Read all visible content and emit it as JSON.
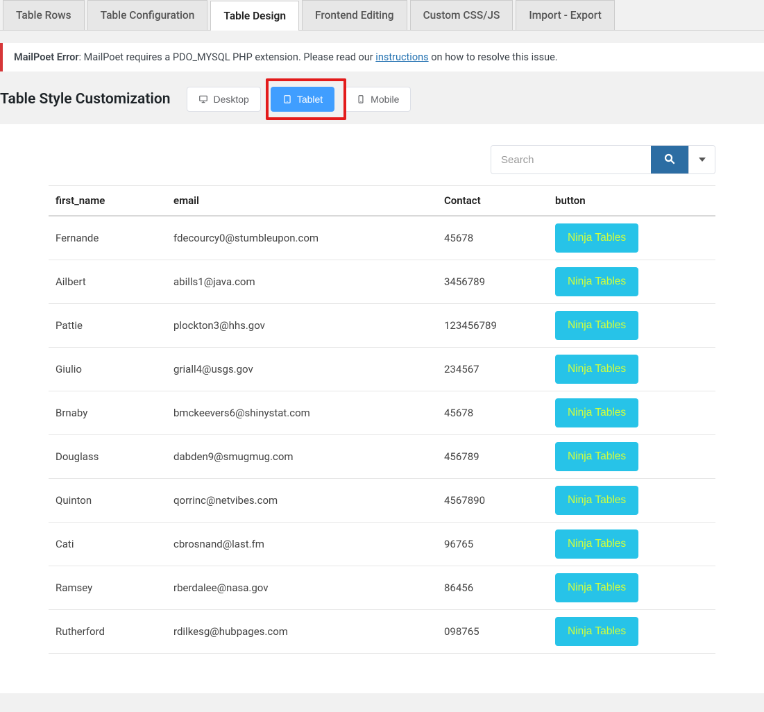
{
  "tabs": [
    {
      "label": "Table Rows",
      "active": false
    },
    {
      "label": "Table Configuration",
      "active": false
    },
    {
      "label": "Table Design",
      "active": true
    },
    {
      "label": "Frontend Editing",
      "active": false
    },
    {
      "label": "Custom CSS/JS",
      "active": false
    },
    {
      "label": "Import - Export",
      "active": false
    }
  ],
  "banner": {
    "prefix": "MailPoet Error",
    "text_before_link": ": MailPoet requires a PDO_MYSQL PHP extension. Please read our ",
    "link_text": "instructions",
    "text_after_link": " on how to resolve this issue."
  },
  "heading": "Table Style Customization",
  "devices": {
    "desktop": "Desktop",
    "tablet": "Tablet",
    "mobile": "Mobile",
    "active": "tablet"
  },
  "search": {
    "placeholder": "Search",
    "value": ""
  },
  "table": {
    "columns": [
      "first_name",
      "email",
      "Contact",
      "button"
    ],
    "button_label": "Ninja Tables",
    "rows": [
      {
        "first_name": "Fernande",
        "email": "fdecourcy0@stumbleupon.com",
        "contact": "45678"
      },
      {
        "first_name": "Ailbert",
        "email": "abills1@java.com",
        "contact": "3456789"
      },
      {
        "first_name": "Pattie",
        "email": "plockton3@hhs.gov",
        "contact": "123456789"
      },
      {
        "first_name": "Giulio",
        "email": "griall4@usgs.gov",
        "contact": "234567"
      },
      {
        "first_name": "Brnaby",
        "email": "bmckeevers6@shinystat.com",
        "contact": "45678"
      },
      {
        "first_name": "Douglass",
        "email": "dabden9@smugmug.com",
        "contact": "456789"
      },
      {
        "first_name": "Quinton",
        "email": "qorrinc@netvibes.com",
        "contact": "4567890"
      },
      {
        "first_name": "Cati",
        "email": "cbrosnand@last.fm",
        "contact": "96765"
      },
      {
        "first_name": "Ramsey",
        "email": "rberdalee@nasa.gov",
        "contact": "86456"
      },
      {
        "first_name": "Rutherford",
        "email": "rdilkesg@hubpages.com",
        "contact": "098765"
      }
    ]
  }
}
